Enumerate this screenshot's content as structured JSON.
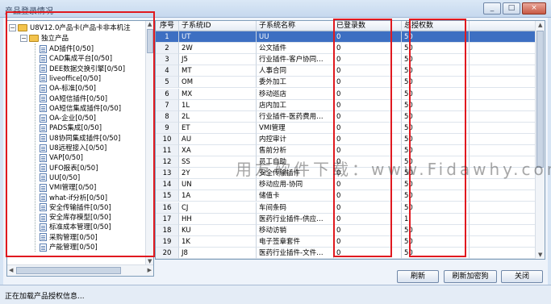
{
  "window": {
    "title": "产品登录情况",
    "buttons": {
      "minimize": "_",
      "restore": "□",
      "close": "×"
    }
  },
  "tree": {
    "root_label": "U8V12.0产品卡(产品卡非本机注",
    "group_label": "独立产品",
    "items": [
      "AD插件[0/50]",
      "CAD集成平台[0/50]",
      "DEE数据交换引擎[0/50]",
      "liveoffice[0/50]",
      "OA-标准[0/50]",
      "OA短信插件[0/50]",
      "OA短信集成插件[0/50]",
      "OA-企业[0/50]",
      "PADS集成[0/50]",
      "U8协同集成插件[0/50]",
      "U8远程接入[0/50]",
      "VAP[0/50]",
      "UFO报表[0/50]",
      "UU[0/50]",
      "VMI管理[0/50]",
      "what-if分析[0/50]",
      "安全传输插件[0/50]",
      "安全库存模型[0/50]",
      "标准成本管理[0/50]",
      "采购管理[0/50]",
      "产能管理[0/50]"
    ]
  },
  "grid": {
    "columns": [
      "序号",
      "子系统ID",
      "子系统名称",
      "已登录数",
      "总授权数",
      ""
    ],
    "rows": [
      [
        "1",
        "UT",
        "UU",
        "0",
        "50"
      ],
      [
        "2",
        "2W",
        "公文插件",
        "0",
        "50"
      ],
      [
        "3",
        "J5",
        "行业插件-客户协同…",
        "0",
        "50"
      ],
      [
        "4",
        "MT",
        "人事合同",
        "0",
        "50"
      ],
      [
        "5",
        "OM",
        "委外加工",
        "0",
        "50"
      ],
      [
        "6",
        "MX",
        "移动巡店",
        "0",
        "50"
      ],
      [
        "7",
        "1L",
        "店内加工",
        "0",
        "50"
      ],
      [
        "8",
        "2L",
        "行业插件-医药费用…",
        "0",
        "50"
      ],
      [
        "9",
        "ET",
        "VMI管理",
        "0",
        "50"
      ],
      [
        "10",
        "AU",
        "内控审计",
        "0",
        "50"
      ],
      [
        "11",
        "XA",
        "售前分析",
        "0",
        "50"
      ],
      [
        "12",
        "SS",
        "员工自助",
        "0",
        "50"
      ],
      [
        "13",
        "2Y",
        "安全传输插件",
        "0",
        "50"
      ],
      [
        "14",
        "UN",
        "移动应用-协同",
        "0",
        "50"
      ],
      [
        "15",
        "1A",
        "储值卡",
        "0",
        "50"
      ],
      [
        "16",
        "CJ",
        "车间条码",
        "0",
        "50"
      ],
      [
        "17",
        "HH",
        "医药行业插件-供应…",
        "0",
        "1"
      ],
      [
        "18",
        "KU",
        "移动访销",
        "0",
        "50"
      ],
      [
        "19",
        "1K",
        "电子签章套件",
        "0",
        "50"
      ],
      [
        "20",
        "J8",
        "医药行业插件-文件…",
        "0",
        "50"
      ]
    ]
  },
  "buttons": {
    "refresh": "刷新",
    "refresh_lock": "刷新加密狗",
    "close": "关闭"
  },
  "status": "正在加载产品授权信息...",
  "watermark": "用友软件下载：www.Fidawhy.com",
  "colors": {
    "selection": "#3d6fc2",
    "highlight_box": "#e0191f"
  }
}
